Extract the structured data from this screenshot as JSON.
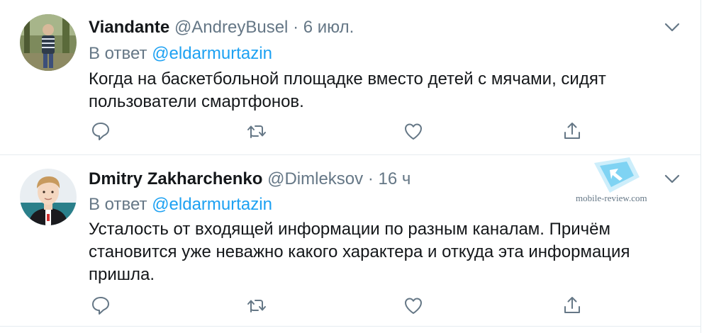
{
  "tweets": [
    {
      "name": "Viandante",
      "handle": "@AndreyBusel",
      "separator": "·",
      "time": "6 июл.",
      "reply_prefix": "В ответ",
      "reply_mention": "@eldarmurtazin",
      "text": "Когда на баскетбольной площадке вместо детей с мячами, сидят пользователи смартфонов."
    },
    {
      "name": "Dmitry Zakharchenko",
      "handle": "@Dimleksov",
      "separator": "·",
      "time": "16 ч",
      "reply_prefix": "В ответ",
      "reply_mention": "@eldarmurtazin",
      "text": "Усталость от входящей информации по разным каналам. Причём становится уже неважно какого характера и откуда эта информация пришла."
    }
  ],
  "icons": [
    "reply-icon",
    "retweet-icon",
    "like-icon",
    "share-icon",
    "chevron-down-icon"
  ],
  "colors": {
    "link": "#1da1f2",
    "muted": "#657786",
    "text": "#14171a",
    "divider": "#e6ecf0"
  },
  "watermark": {
    "text": "mobile-review.com"
  }
}
